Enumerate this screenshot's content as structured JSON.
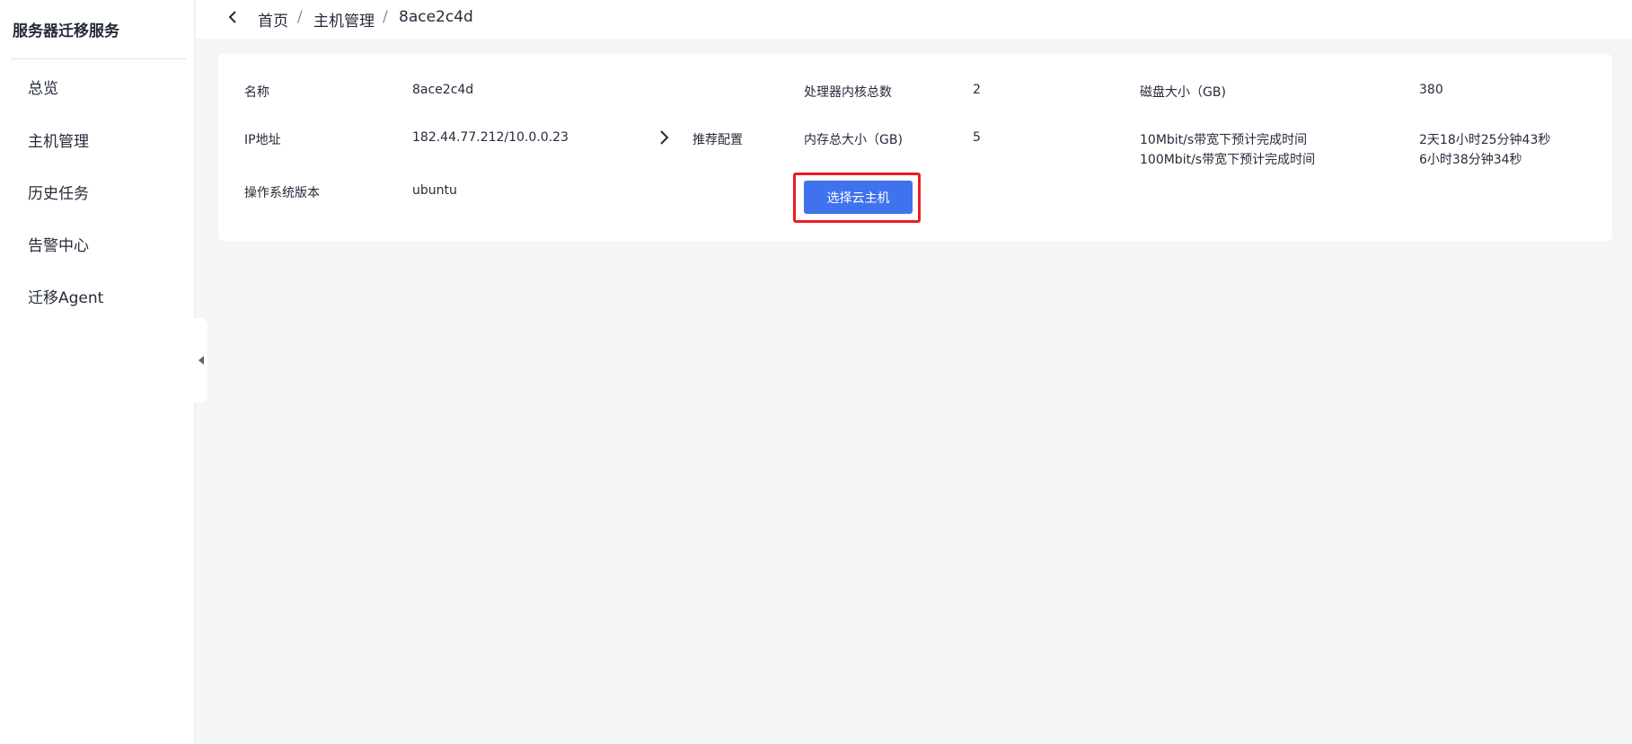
{
  "sidebar": {
    "title": "服务器迁移服务",
    "items": [
      {
        "label": "总览"
      },
      {
        "label": "主机管理"
      },
      {
        "label": "历史任务"
      },
      {
        "label": "告警中心"
      },
      {
        "label": "迁移Agent"
      }
    ]
  },
  "breadcrumb": {
    "items": [
      "首页",
      "主机管理",
      "8ace2c4d"
    ],
    "separator": "/"
  },
  "detail": {
    "name_label": "名称",
    "name_value": "8ace2c4d",
    "ip_label": "IP地址",
    "ip_value": "182.44.77.212/10.0.0.23",
    "os_label": "操作系统版本",
    "os_value": "ubuntu",
    "recommend_label": "推荐配置",
    "cpu_label": "处理器内核总数",
    "cpu_value": "2",
    "mem_label": "内存总大小（GB)",
    "mem_value": "5",
    "disk_label": "磁盘大小（GB)",
    "disk_value": "380",
    "bw10_label": "10Mbit/s带宽下预计完成时间",
    "bw10_value": "2天18小时25分钟43秒",
    "bw100_label": "100Mbit/s带宽下预计完成时间",
    "bw100_value": "6小时38分钟34秒",
    "select_button": "选择云主机"
  },
  "colors": {
    "primary": "#4072ee",
    "highlight": "#ec1c24",
    "text": "#252b3a",
    "background": "#f4f5f7"
  },
  "icons": {
    "back": "chevron-left-icon",
    "recommend_arrow": "chevron-right-icon",
    "collapse": "caret-left-icon"
  }
}
